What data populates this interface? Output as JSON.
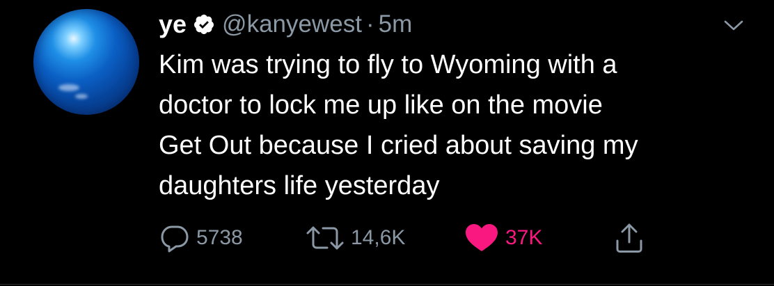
{
  "author": {
    "display_name": "ye",
    "handle": "@kanyewest",
    "separator": "·",
    "time": "5m",
    "verified": true,
    "avatar": "blue-globe-avatar"
  },
  "tweet": {
    "text": "Kim was trying to fly to Wyoming with a\ndoctor to lock me up like on the movie\nGet Out because I cried about saving my\ndaughters life yesterday"
  },
  "actions": {
    "reply": {
      "icon": "reply-icon",
      "count": "5738"
    },
    "retweet": {
      "icon": "retweet-icon",
      "count": "14,6K"
    },
    "like": {
      "icon": "heart-filled-icon",
      "count": "37K",
      "liked": true,
      "color": "#f91880"
    },
    "share": {
      "icon": "share-icon"
    }
  },
  "menu": {
    "icon": "chevron-down-icon"
  },
  "colors": {
    "background": "#000000",
    "text": "#ffffff",
    "muted": "#8b98a5",
    "like": "#f91880"
  }
}
